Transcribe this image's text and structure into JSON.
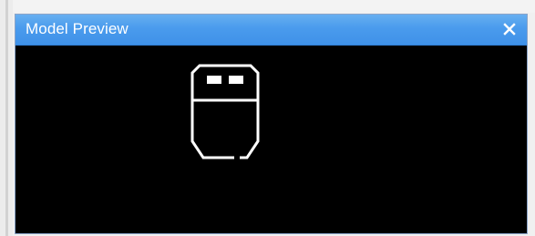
{
  "window": {
    "title": "Model Preview",
    "close_icon": "close-icon"
  },
  "viewport": {
    "background": "#000000",
    "model_icon": "robot-head-outline-icon",
    "model_color": "#ffffff"
  },
  "colors": {
    "titlebar": "#4a9bed",
    "title_text": "#ffffff"
  }
}
